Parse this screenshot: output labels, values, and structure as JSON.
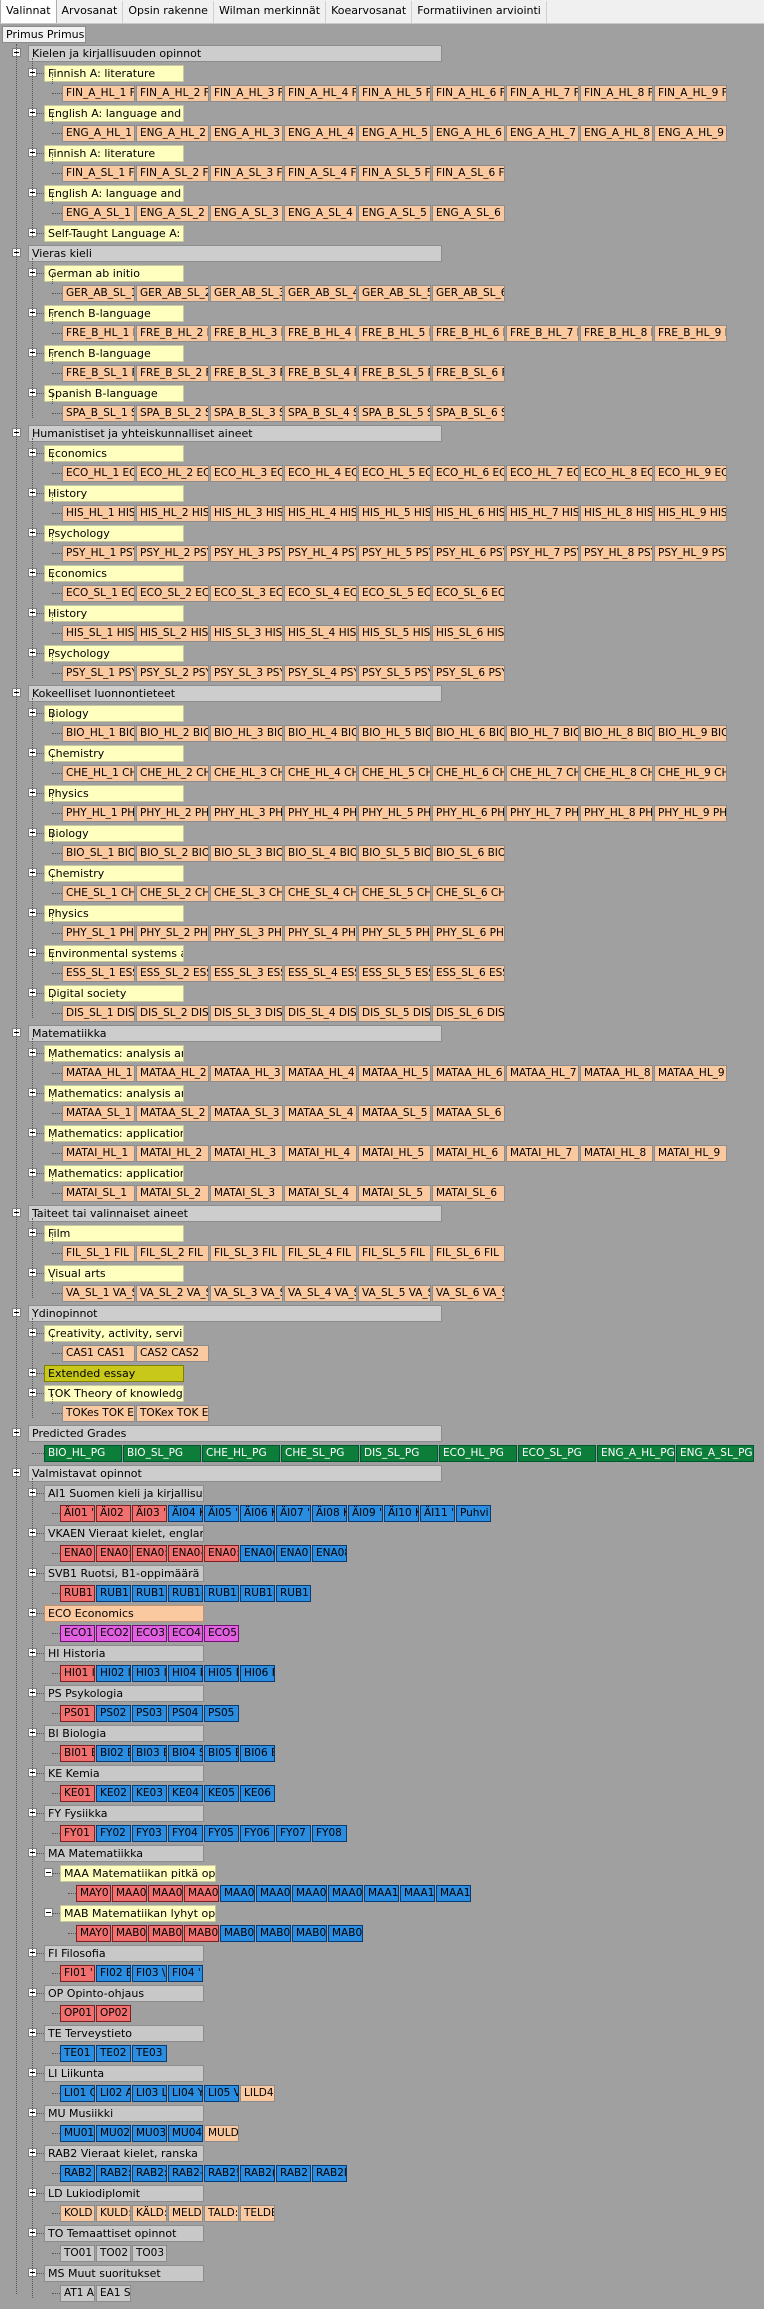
{
  "tabs": [
    "Valinnat",
    "Arvosanat",
    "Opsin rakenne",
    "Wilman merkinnät",
    "Koearvosanat",
    "Formatiivinen arviointi"
  ],
  "active_tab": 0,
  "root": "Primus Primus",
  "groups": [
    {
      "title": "Kielen ja kirjallisuuden opinnot",
      "children": [
        {
          "title": "Finnish A: literature",
          "courses": [
            "FIN_A_HL_1 F",
            "FIN_A_HL_2 F",
            "FIN_A_HL_3 F",
            "FIN_A_HL_4 F",
            "FIN_A_HL_5 F",
            "FIN_A_HL_6 F",
            "FIN_A_HL_7 F",
            "FIN_A_HL_8 F",
            "FIN_A_HL_9 F"
          ]
        },
        {
          "title": "English A: language and liter",
          "courses": [
            "ENG_A_HL_1 E",
            "ENG_A_HL_2 E",
            "ENG_A_HL_3 E",
            "ENG_A_HL_4 E",
            "ENG_A_HL_5 E",
            "ENG_A_HL_6 E",
            "ENG_A_HL_7 E",
            "ENG_A_HL_8 E",
            "ENG_A_HL_9 E"
          ]
        },
        {
          "title": "Finnish A: literature",
          "courses": [
            "FIN_A_SL_1 F",
            "FIN_A_SL_2 F",
            "FIN_A_SL_3 F",
            "FIN_A_SL_4 F",
            "FIN_A_SL_5 F",
            "FIN_A_SL_6 F"
          ]
        },
        {
          "title": "English A: language and liter",
          "courses": [
            "ENG_A_SL_1 E",
            "ENG_A_SL_2 E",
            "ENG_A_SL_3 E",
            "ENG_A_SL_4 E",
            "ENG_A_SL_5 E",
            "ENG_A_SL_6 E"
          ]
        },
        {
          "title": "Self-Taught Language A: Lit",
          "courses": []
        }
      ]
    },
    {
      "title": "Vieras kieli",
      "children": [
        {
          "title": "German ab initio",
          "courses": [
            "GER_AB_SL_1",
            "GER_AB_SL_2",
            "GER_AB_SL_3",
            "GER_AB_SL_4",
            "GER_AB_SL_5",
            "GER_AB_SL_6"
          ]
        },
        {
          "title": "French B-language",
          "courses": [
            "FRE_B_HL_1 F",
            "FRE_B_HL_2 F",
            "FRE_B_HL_3 F",
            "FRE_B_HL_4 F",
            "FRE_B_HL_5 F",
            "FRE_B_HL_6 F",
            "FRE_B_HL_7 F",
            "FRE_B_HL_8 F",
            "FRE_B_HL_9 F"
          ]
        },
        {
          "title": "French B-language",
          "courses": [
            "FRE_B_SL_1 F",
            "FRE_B_SL_2 F",
            "FRE_B_SL_3 F",
            "FRE_B_SL_4 F",
            "FRE_B_SL_5 F",
            "FRE_B_SL_6 F"
          ]
        },
        {
          "title": "Spanish B-language",
          "courses": [
            "SPA_B_SL_1 S",
            "SPA_B_SL_2 S",
            "SPA_B_SL_3 S",
            "SPA_B_SL_4 S",
            "SPA_B_SL_5 S",
            "SPA_B_SL_6 S"
          ]
        }
      ]
    },
    {
      "title": "Humanistiset ja yhteiskunnalliset aineet",
      "children": [
        {
          "title": "Economics",
          "courses": [
            "ECO_HL_1 ECO",
            "ECO_HL_2 ECO",
            "ECO_HL_3 ECO",
            "ECO_HL_4 ECO",
            "ECO_HL_5 ECO",
            "ECO_HL_6 ECO",
            "ECO_HL_7 ECO",
            "ECO_HL_8 ECO",
            "ECO_HL_9 ECO"
          ]
        },
        {
          "title": "History",
          "courses": [
            "HIS_HL_1 HIS",
            "HIS_HL_2 HIS",
            "HIS_HL_3 HIS",
            "HIS_HL_4 HIS",
            "HIS_HL_5 HIS",
            "HIS_HL_6 HIS",
            "HIS_HL_7 HIS",
            "HIS_HL_8 HIS",
            "HIS_HL_9 HIS"
          ]
        },
        {
          "title": "Psychology",
          "courses": [
            "PSY_HL_1 PSY",
            "PSY_HL_2 PSY",
            "PSY_HL_3 PSY",
            "PSY_HL_4 PSY",
            "PSY_HL_5 PSY",
            "PSY_HL_6 PSY",
            "PSY_HL_7 PSY",
            "PSY_HL_8 PSY",
            "PSY_HL_9 PSY"
          ]
        },
        {
          "title": "Economics",
          "courses": [
            "ECO_SL_1 ECO",
            "ECO_SL_2 ECO",
            "ECO_SL_3 ECO",
            "ECO_SL_4 ECO",
            "ECO_SL_5 ECO",
            "ECO_SL_6 ECO"
          ]
        },
        {
          "title": "History",
          "courses": [
            "HIS_SL_1 HIS",
            "HIS_SL_2 HIS",
            "HIS_SL_3 HIS",
            "HIS_SL_4 HIS",
            "HIS_SL_5 HIS",
            "HIS_SL_6 HIS"
          ]
        },
        {
          "title": "Psychology",
          "courses": [
            "PSY_SL_1 PSY",
            "PSY_SL_2 PSY",
            "PSY_SL_3 PSY",
            "PSY_SL_4 PSY",
            "PSY_SL_5 PSY",
            "PSY_SL_6 PSY"
          ]
        }
      ]
    },
    {
      "title": "Kokeelliset luonnontieteet",
      "children": [
        {
          "title": "Biology",
          "courses": [
            "BIO_HL_1 BIO",
            "BIO_HL_2 BIO",
            "BIO_HL_3 BIO",
            "BIO_HL_4 BIO",
            "BIO_HL_5 BIO",
            "BIO_HL_6 BIO",
            "BIO_HL_7 BIO",
            "BIO_HL_8 BIO",
            "BIO_HL_9 BIO"
          ]
        },
        {
          "title": "Chemistry",
          "courses": [
            "CHE_HL_1 CHE",
            "CHE_HL_2 CHE",
            "CHE_HL_3 CHE",
            "CHE_HL_4 CHE",
            "CHE_HL_5 CHE",
            "CHE_HL_6 CHE",
            "CHE_HL_7 CHE",
            "CHE_HL_8 CHE",
            "CHE_HL_9 CHE"
          ]
        },
        {
          "title": "Physics",
          "courses": [
            "PHY_HL_1 PHY",
            "PHY_HL_2 PHY",
            "PHY_HL_3 PHY",
            "PHY_HL_4 PHY",
            "PHY_HL_5 PHY",
            "PHY_HL_6 PHY",
            "PHY_HL_7 PHY",
            "PHY_HL_8 PHY",
            "PHY_HL_9 PHY"
          ]
        },
        {
          "title": "Biology",
          "courses": [
            "BIO_SL_1 BIO",
            "BIO_SL_2 BIO",
            "BIO_SL_3 BIO",
            "BIO_SL_4 BIO",
            "BIO_SL_5 BIO",
            "BIO_SL_6 BIO"
          ]
        },
        {
          "title": "Chemistry",
          "courses": [
            "CHE_SL_1 CHE",
            "CHE_SL_2 CHE",
            "CHE_SL_3 CHE",
            "CHE_SL_4 CHE",
            "CHE_SL_5 CHE",
            "CHE_SL_6 CHE"
          ]
        },
        {
          "title": "Physics",
          "courses": [
            "PHY_SL_1 PHY",
            "PHY_SL_2 PHY",
            "PHY_SL_3 PHY",
            "PHY_SL_4 PHY",
            "PHY_SL_5 PHY",
            "PHY_SL_6 PHY"
          ]
        },
        {
          "title": "Environmental systems and",
          "courses": [
            "ESS_SL_1 ESS",
            "ESS_SL_2 ESS",
            "ESS_SL_3 ESS",
            "ESS_SL_4 ESS",
            "ESS_SL_5 ESS",
            "ESS_SL_6 ESS"
          ]
        },
        {
          "title": "Digital society",
          "courses": [
            "DIS_SL_1 DIS",
            "DIS_SL_2 DIS",
            "DIS_SL_3 DIS",
            "DIS_SL_4 DIS",
            "DIS_SL_5 DIS",
            "DIS_SL_6 DIS"
          ]
        }
      ]
    },
    {
      "title": "Matematiikka",
      "children": [
        {
          "title": "Mathematics: analysis and a",
          "courses": [
            "MATAA_HL_1",
            "MATAA_HL_2",
            "MATAA_HL_3",
            "MATAA_HL_4",
            "MATAA_HL_5",
            "MATAA_HL_6",
            "MATAA_HL_7",
            "MATAA_HL_8",
            "MATAA_HL_9"
          ]
        },
        {
          "title": "Mathematics: analysis and a",
          "courses": [
            "MATAA_SL_1",
            "MATAA_SL_2",
            "MATAA_SL_3",
            "MATAA_SL_4",
            "MATAA_SL_5",
            "MATAA_SL_6"
          ]
        },
        {
          "title": "Mathematics: applications ar",
          "courses": [
            "MATAI_HL_1",
            "MATAI_HL_2",
            "MATAI_HL_3",
            "MATAI_HL_4",
            "MATAI_HL_5",
            "MATAI_HL_6",
            "MATAI_HL_7",
            "MATAI_HL_8",
            "MATAI_HL_9"
          ]
        },
        {
          "title": "Mathematics: applications ar",
          "courses": [
            "MATAI_SL_1",
            "MATAI_SL_2",
            "MATAI_SL_3",
            "MATAI_SL_4",
            "MATAI_SL_5",
            "MATAI_SL_6"
          ]
        }
      ]
    },
    {
      "title": "Taiteet tai valinnaiset aineet",
      "children": [
        {
          "title": "Film",
          "courses": [
            "FIL_SL_1 FIL",
            "FIL_SL_2 FIL",
            "FIL_SL_3 FIL",
            "FIL_SL_4 FIL",
            "FIL_SL_5 FIL",
            "FIL_SL_6 FIL"
          ]
        },
        {
          "title": "Visual arts",
          "courses": [
            "VA_SL_1 VA_S",
            "VA_SL_2 VA_S",
            "VA_SL_3 VA_S",
            "VA_SL_4 VA_S",
            "VA_SL_5 VA_S",
            "VA_SL_6 VA_S"
          ]
        }
      ]
    },
    {
      "title": "Ydinopinnot",
      "children": [
        {
          "title": "Creativity, activity, service",
          "courses": [
            "CAS1 CAS1",
            "CAS2 CAS2"
          ]
        },
        {
          "title": "Extended essay",
          "courses": [],
          "olive": true
        },
        {
          "title": "TOK Theory of knowledge",
          "courses": [
            "TOKes TOK Es",
            "TOKex TOK Ex"
          ]
        }
      ]
    }
  ],
  "predicted": {
    "title": "Predicted Grades",
    "items": [
      "BIO_HL_PG",
      "BIO_SL_PG",
      "CHE_HL_PG",
      "CHE_SL_PG",
      "DIS_SL_PG",
      "ECO_HL_PG",
      "ECO_SL_PG",
      "ENG_A_HL_PG",
      "ENG_A_SL_PG"
    ]
  },
  "valmistavat": {
    "title": "Valmistavat opinnot",
    "children": [
      {
        "title": "AI1 Suomen kieli ja kirjallisuu",
        "items": [
          [
            "ÄI01 '",
            "red"
          ],
          [
            "ÄI02 ",
            "red"
          ],
          [
            "ÄI03 '",
            "red"
          ],
          [
            "ÄI04 K",
            "blue"
          ],
          [
            "ÄI05 '",
            "blue"
          ],
          [
            "ÄI06 K",
            "blue"
          ],
          [
            "ÄI07 '",
            "blue"
          ],
          [
            "ÄI08 K",
            "blue"
          ],
          [
            "ÄI09 '",
            "blue"
          ],
          [
            "ÄI10 K",
            "blue"
          ],
          [
            "ÄI11 '",
            "blue"
          ],
          [
            "Puhvi",
            "blue"
          ]
        ]
      },
      {
        "title": "VKAEN Vieraat kielet, englan",
        "items": [
          [
            "ENA0",
            "red"
          ],
          [
            "ENA0:",
            "red"
          ],
          [
            "ENA0:",
            "red"
          ],
          [
            "ENA0-",
            "red"
          ],
          [
            "ENA0:",
            "red"
          ],
          [
            "ENA0(",
            "blue"
          ],
          [
            "ENA0",
            "blue"
          ],
          [
            "ENA08",
            "blue"
          ]
        ]
      },
      {
        "title": "SVB1 Ruotsi, B1-oppimäärä",
        "items": [
          [
            "RUB1",
            "red"
          ],
          [
            "RUB1:",
            "blue"
          ],
          [
            "RUB1:",
            "blue"
          ],
          [
            "RUB1-",
            "blue"
          ],
          [
            "RUB1!",
            "blue"
          ],
          [
            "RUB1(",
            "blue"
          ],
          [
            "RUB1",
            "blue"
          ]
        ]
      },
      {
        "title": "ECO Economics",
        "items": [
          [
            "ECO1",
            "mag"
          ],
          [
            "ECO2",
            "mag"
          ],
          [
            "ECO3",
            "mag"
          ],
          [
            "ECO4",
            "mag"
          ],
          [
            "ECO5",
            "mag"
          ]
        ],
        "peach": true
      },
      {
        "title": "HI Historia",
        "items": [
          [
            "HI01 l",
            "red"
          ],
          [
            "HI02 l",
            "blue"
          ],
          [
            "HI03 l",
            "blue"
          ],
          [
            "HI04 E",
            "blue"
          ],
          [
            "HI05 F",
            "blue"
          ],
          [
            "HI06 F",
            "blue"
          ]
        ]
      },
      {
        "title": "PS Psykologia",
        "items": [
          [
            "PS01 '",
            "red"
          ],
          [
            "PS02 E",
            "blue"
          ],
          [
            "PS03 '",
            "blue"
          ],
          [
            "PS04 '",
            "blue"
          ],
          [
            "PS05 '",
            "blue"
          ]
        ]
      },
      {
        "title": "BI Biologia",
        "items": [
          [
            "BI01 E",
            "red"
          ],
          [
            "BI02 E",
            "blue"
          ],
          [
            "BI03 E",
            "blue"
          ],
          [
            "BI04 S",
            "blue"
          ],
          [
            "BI05 E",
            "blue"
          ],
          [
            "BI06 E",
            "blue"
          ]
        ]
      },
      {
        "title": "KE Kemia",
        "items": [
          [
            "KE01 l",
            "red"
          ],
          [
            "KE02 l",
            "blue"
          ],
          [
            "KE03 l",
            "blue"
          ],
          [
            "KE04 l",
            "blue"
          ],
          [
            "KE05 l",
            "blue"
          ],
          [
            "KE06 l",
            "blue"
          ]
        ]
      },
      {
        "title": "FY Fysiikka",
        "items": [
          [
            "FY01 ",
            "red"
          ],
          [
            "FY02 l",
            "blue"
          ],
          [
            "FY03 l",
            "blue"
          ],
          [
            "FY04 '",
            "blue"
          ],
          [
            "FY05 ",
            "blue"
          ],
          [
            "FY06 '",
            "blue"
          ],
          [
            "FY07 '",
            "blue"
          ],
          [
            "FY08 ",
            "blue"
          ]
        ]
      },
      {
        "title": "MA Matematiikka",
        "items": [],
        "nested": [
          {
            "title": "MAA Matematiikan pitkä opp",
            "items": [
              [
                "MAY0",
                "red"
              ],
              [
                "MAA0",
                "red"
              ],
              [
                "MAA0",
                "red"
              ],
              [
                "MAA0",
                "red"
              ],
              [
                "MAA0",
                "blue"
              ],
              [
                "MAA0",
                "blue"
              ],
              [
                "MAA0",
                "blue"
              ],
              [
                "MAA0",
                "blue"
              ],
              [
                "MAA1",
                "blue"
              ],
              [
                "MAA1",
                "blue"
              ],
              [
                "MAA1",
                "blue"
              ]
            ]
          },
          {
            "title": "MAB Matematiikan lyhyt opp",
            "items": [
              [
                "MAY0",
                "red"
              ],
              [
                "MAB0",
                "red"
              ],
              [
                "MAB0",
                "red"
              ],
              [
                "MAB0",
                "red"
              ],
              [
                "MAB0",
                "blue"
              ],
              [
                "MAB0",
                "blue"
              ],
              [
                "MAB0",
                "blue"
              ],
              [
                "MAB0",
                "blue"
              ]
            ]
          }
        ]
      },
      {
        "title": "FI Filosofia",
        "items": [
          [
            "FI01 '",
            "red"
          ],
          [
            "FI02 E",
            "blue"
          ],
          [
            "FI03 \\",
            "blue"
          ],
          [
            "FI04 '",
            "blue"
          ]
        ]
      },
      {
        "title": "OP Opinto-ohjaus",
        "items": [
          [
            "OP01",
            "red"
          ],
          [
            "OP02",
            "red"
          ]
        ]
      },
      {
        "title": "TE Terveystieto",
        "items": [
          [
            "TE01 '",
            "blue"
          ],
          [
            "TE02 '",
            "blue"
          ],
          [
            "TE03 '",
            "blue"
          ]
        ]
      },
      {
        "title": "LI Liikunta",
        "items": [
          [
            "LI01 C",
            "blue"
          ],
          [
            "LI02 A",
            "blue"
          ],
          [
            "LI03 L",
            "blue"
          ],
          [
            "LI04 Y",
            "blue"
          ],
          [
            "LI05 V",
            "blue"
          ],
          [
            "LILD4",
            "peach"
          ]
        ]
      },
      {
        "title": "MU Musiikki",
        "items": [
          [
            "MU01",
            "blue"
          ],
          [
            "MU02",
            "blue"
          ],
          [
            "MU03",
            "blue"
          ],
          [
            "MU04",
            "blue"
          ],
          [
            "MULD(",
            "peach"
          ]
        ]
      },
      {
        "title": "RAB2 Vieraat kielet, ranska",
        "items": [
          [
            "RAB2",
            "blue"
          ],
          [
            "RAB2:",
            "blue"
          ],
          [
            "RAB2:",
            "blue"
          ],
          [
            "RAB2-",
            "blue"
          ],
          [
            "RAB2!",
            "blue"
          ],
          [
            "RAB2(",
            "blue"
          ],
          [
            "RAB2",
            "blue"
          ],
          [
            "RAB2l",
            "blue"
          ]
        ]
      },
      {
        "title": "LD Lukiodiplomit",
        "items": [
          [
            "KOLD",
            "peach"
          ],
          [
            "KULD:",
            "peach"
          ],
          [
            "KÄLD:",
            "peach"
          ],
          [
            "MELD!",
            "peach"
          ],
          [
            "TALD:",
            "peach"
          ],
          [
            "TELDE",
            "peach"
          ]
        ]
      },
      {
        "title": "TO Temaattiset opinnot",
        "items": [
          [
            "TO01",
            "plain"
          ],
          [
            "TO02",
            "plain"
          ],
          [
            "TO03",
            "plain"
          ]
        ]
      },
      {
        "title": "MS Muut suoritukset",
        "items": [
          [
            "AT1 A",
            "plain"
          ],
          [
            "EA1 S",
            "plain"
          ]
        ]
      }
    ]
  }
}
